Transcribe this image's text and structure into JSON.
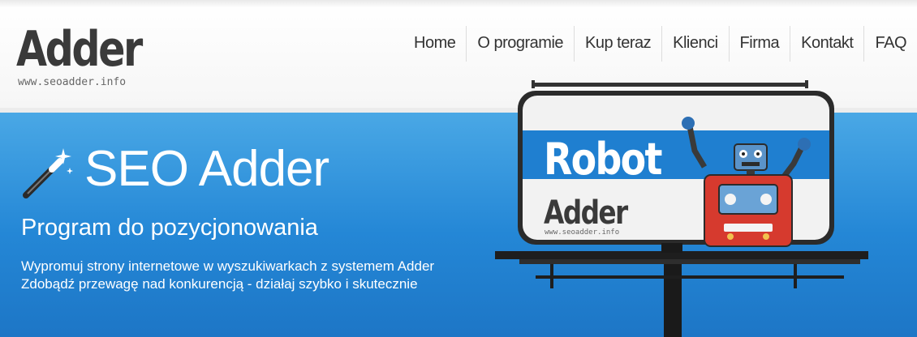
{
  "logo": {
    "main": "Adder",
    "url": "www.seoadder.info"
  },
  "nav": {
    "items": [
      {
        "label": "Home"
      },
      {
        "label": "O programie"
      },
      {
        "label": "Kup teraz"
      },
      {
        "label": "Klienci"
      },
      {
        "label": "Firma"
      },
      {
        "label": "Kontakt"
      },
      {
        "label": "FAQ"
      }
    ]
  },
  "hero": {
    "title": "SEO Adder",
    "subtitle": "Program do pozycjonowania",
    "line1": "Wypromuj strony internetowe w wyszukiwarkach z systemem Adder",
    "line2": "Zdobądź przewagę nad konkurencją - działaj szybko i skutecznie"
  },
  "billboard": {
    "word1": "Robot",
    "word2": "Adder",
    "url": "www.seoadder.info"
  },
  "colors": {
    "banner": "#2487d6",
    "stripe": "#1f7fd0",
    "logo": "#3a3a3a",
    "robot_body": "#d63a2e"
  },
  "icons": [
    "magic-wand-icon",
    "robot-illustration"
  ]
}
